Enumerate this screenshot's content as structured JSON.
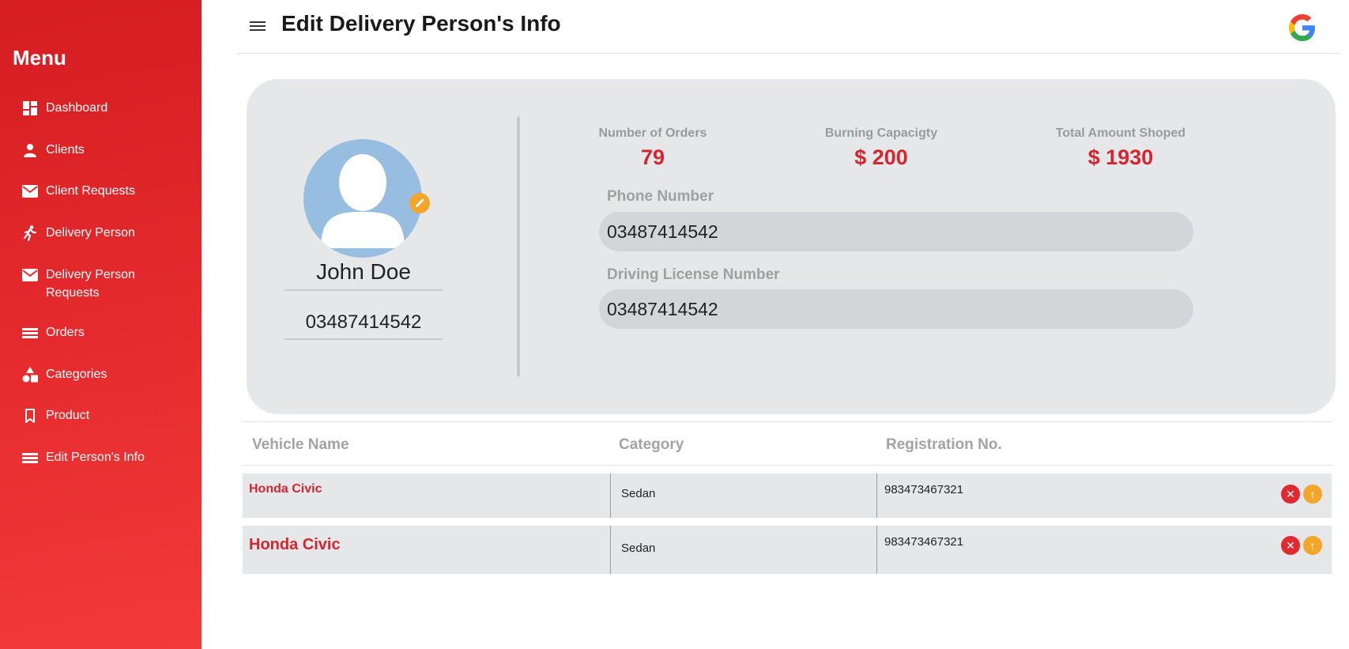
{
  "sidebar": {
    "title": "Menu",
    "items": [
      {
        "label": "Dashboard",
        "icon": "dashboard-icon"
      },
      {
        "label": "Clients",
        "icon": "person-icon"
      },
      {
        "label": "Client Requests",
        "icon": "mail-icon"
      },
      {
        "label": "Delivery Person",
        "icon": "running-person-icon"
      },
      {
        "label": "Delivery Person Requests",
        "icon": "mail-icon"
      },
      {
        "label": "Orders",
        "icon": "list-icon"
      },
      {
        "label": "Categories",
        "icon": "shapes-icon"
      },
      {
        "label": "Product",
        "icon": "bookmark-icon"
      },
      {
        "label": "Edit Person's Info",
        "icon": "list-icon"
      }
    ]
  },
  "header": {
    "title": "Edit Delivery Person's Info"
  },
  "profile": {
    "name": "John Doe",
    "phone": "03487414542"
  },
  "stats": [
    {
      "label": "Number of Orders",
      "value": "79"
    },
    {
      "label": "Burning Capacigty",
      "value": "$ 200"
    },
    {
      "label": "Total Amount Shoped",
      "value": "$ 1930"
    }
  ],
  "fields": {
    "phone_label": "Phone Number",
    "phone_value": "03487414542",
    "license_label": "Driving License Number",
    "license_value": "03487414542"
  },
  "table": {
    "headers": [
      "Vehicle Name",
      "Category",
      "Registration No."
    ],
    "rows": [
      {
        "vehicle": "Honda Civic",
        "category": "Sedan",
        "registration": "983473467321"
      },
      {
        "vehicle": "Honda Civic",
        "category": "Sedan",
        "registration": "983473467321"
      }
    ]
  },
  "colors": {
    "sidebar_red": "#e42a2d",
    "accent_red": "#d42530",
    "edit_orange": "#f2a62b",
    "card_gray": "#e6e7e9"
  }
}
